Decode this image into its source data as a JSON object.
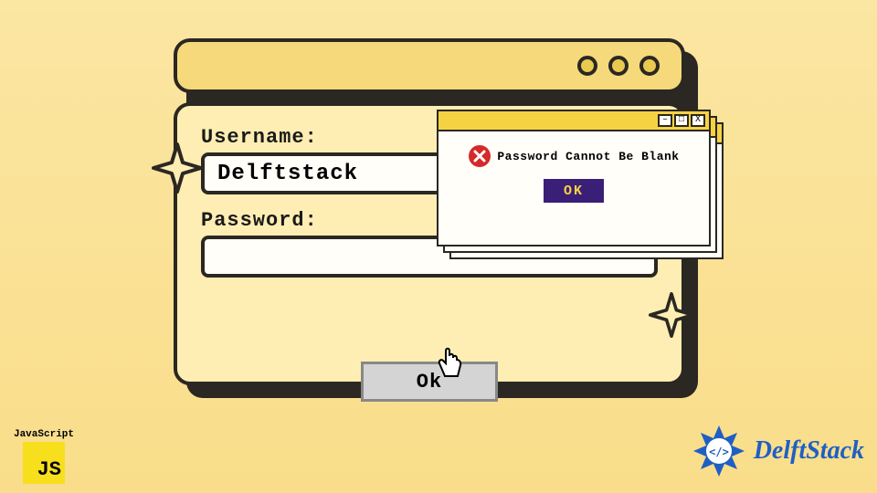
{
  "form": {
    "username_label": "Username:",
    "username_value": "Delftstack",
    "password_label": "Password:",
    "password_value": "",
    "ok_label": "Ok"
  },
  "popup": {
    "message": "Password Cannot Be Blank",
    "ok_label": "OK",
    "buttons": {
      "minimize": "–",
      "maximize": "□",
      "close": "X"
    }
  },
  "branding": {
    "js_label": "JavaScript",
    "js_glyph": "JS",
    "delft_text": "DelftStack"
  },
  "colors": {
    "accent_yellow": "#f5d97a",
    "border_dark": "#2b2722",
    "popup_ok_bg": "#3a1f78",
    "error_red": "#d42a2a",
    "brand_blue": "#1f5fc4"
  }
}
